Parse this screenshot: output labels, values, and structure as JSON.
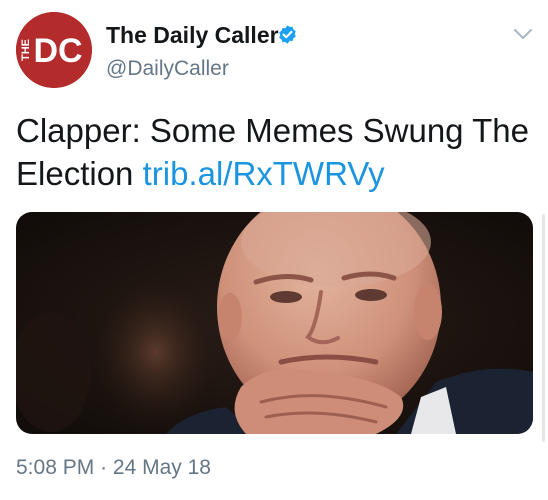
{
  "account": {
    "display_name": "The Daily Caller",
    "handle": "@DailyCaller",
    "avatar_text_small": "THE",
    "avatar_text_large": "DC",
    "verified": true
  },
  "tweet": {
    "text": "Clapper: Some Memes Swung The Election ",
    "link": "trib.al/RxTWRVy",
    "time": "5:08 PM",
    "separator": "·",
    "date": "24 May 18",
    "media_alt": "photo-of-man-resting-chin-on-hand"
  },
  "icons": {
    "verified": "verified-badge-icon",
    "menu": "chevron-down-icon"
  },
  "colors": {
    "brand_red": "#b32b2b",
    "link_blue": "#1b95e0",
    "verified_blue": "#1da1f2",
    "text_primary": "#14171a",
    "text_secondary": "#657786"
  }
}
